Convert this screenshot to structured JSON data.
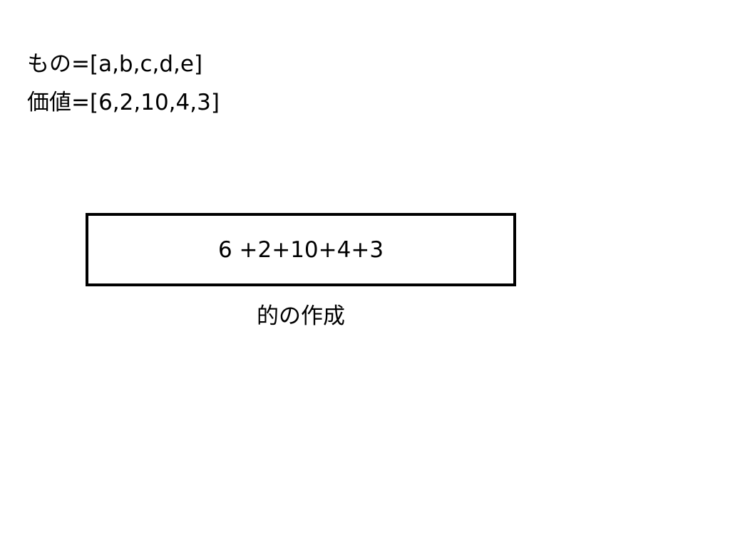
{
  "items_line": "もの=[a,b,c,d,e]",
  "values_line": "価値=[6,2,10,4,3]",
  "box": {
    "expression": "6 +2+10+4+3"
  },
  "caption": "的の作成"
}
